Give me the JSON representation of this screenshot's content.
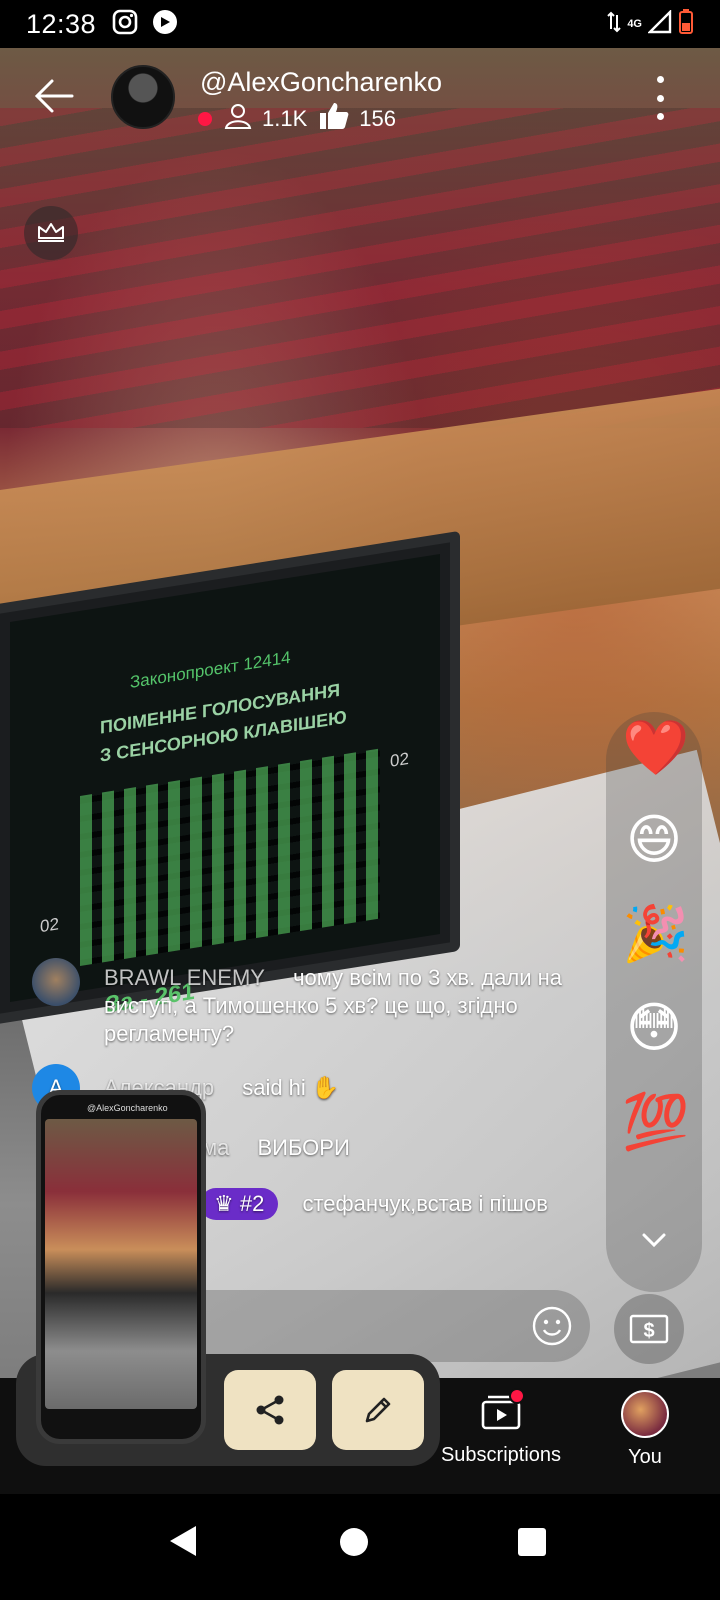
{
  "status_bar": {
    "time": "12:38",
    "network": "4G",
    "icons": [
      "instagram-icon",
      "media-icon",
      "data-transfer-icon",
      "signal-icon",
      "battery-low-icon"
    ]
  },
  "live": {
    "channel_name": "@AlexGoncharenko",
    "viewers": "1.1K",
    "likes": "156",
    "live_indicator_color": "#ff1744"
  },
  "video": {
    "screen_title": "Законопроект 12414",
    "screen_line1": "ПОІМЕННЕ ГОЛОСУВАННЯ",
    "screen_line2": "З СЕНСОРНОЮ КЛАВІШЕЮ",
    "screen_left_num": "02",
    "screen_right_num": "02",
    "screen_tally": "За - 261"
  },
  "chat": [
    {
      "name": "BRAWL ENEMY",
      "text": "чому всім по 3 хв. дали на виступ, а Тимошенко 5 хв? це що, згідно регламенту?"
    },
    {
      "name": "Александр",
      "text": "said hi",
      "avatar_letter": "A"
    },
    {
      "name": "ма",
      "text": "ВИБОРИ"
    },
    {
      "badge": "#2",
      "text": "стефанчук,встав і пішов"
    }
  ],
  "reactions": [
    "❤️",
    "😄",
    "🎉",
    "😳",
    "💯"
  ],
  "bottom_nav": {
    "subscriptions_label": "Subscriptions",
    "you_label": "You"
  },
  "preview": {
    "channel_name": "@AlexGoncharenko"
  },
  "colors": {
    "badge_purple": "#6a2cc8",
    "action_button_bg": "#efe2c2",
    "notification_red": "#ff1744"
  }
}
